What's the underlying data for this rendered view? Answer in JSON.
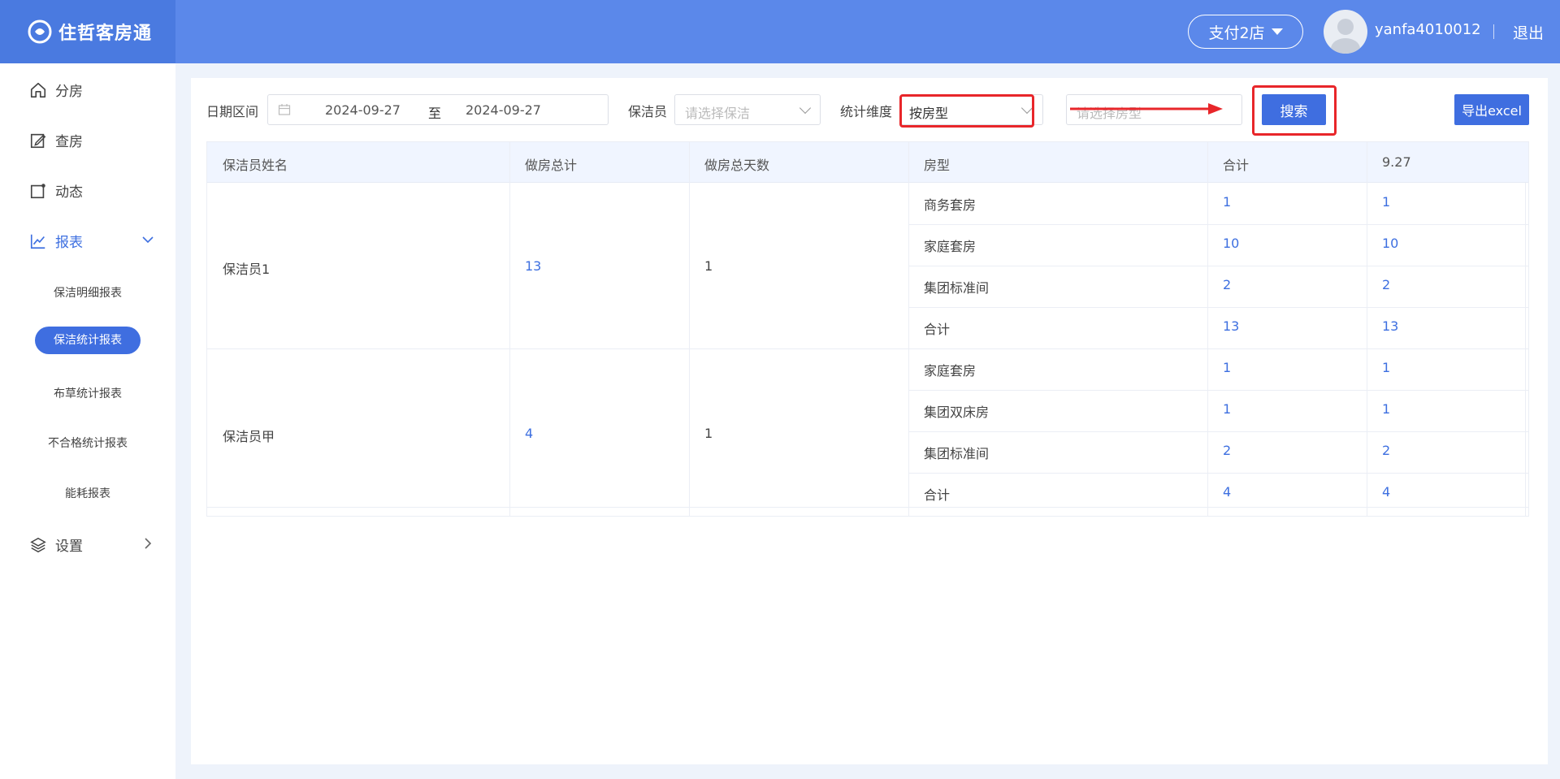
{
  "header": {
    "logo_text": "住哲客房通",
    "store_label": "支付2店",
    "username": "yanfa4010012",
    "logout_label": "退出"
  },
  "sidebar": {
    "items": [
      {
        "label": "分房",
        "icon": "home-icon"
      },
      {
        "label": "查房",
        "icon": "edit-icon"
      },
      {
        "label": "动态",
        "icon": "activity-icon"
      },
      {
        "label": "报表",
        "icon": "chart-icon"
      },
      {
        "label": "设置",
        "icon": "layers-icon"
      }
    ],
    "sub_items": [
      "保洁明细报表",
      "保洁统计报表",
      "布草统计报表",
      "不合格统计报表",
      "能耗报表"
    ]
  },
  "filters": {
    "date_label": "日期区间",
    "date_start": "2024-09-27",
    "date_sep": "至",
    "date_end": "2024-09-27",
    "cleaner_label": "保洁员",
    "cleaner_placeholder": "请选择保洁",
    "dimension_label": "统计维度",
    "dimension_value": "按房型",
    "roomtype_placeholder": "请选择房型",
    "search_label": "搜索",
    "export_label": "导出excel"
  },
  "table": {
    "headers": [
      "保洁员姓名",
      "做房总计",
      "做房总天数",
      "房型",
      "合计",
      "9.27"
    ],
    "groups": [
      {
        "name": "保洁员1",
        "total": "13",
        "days": "1",
        "rows": [
          {
            "type": "商务套房",
            "sum": "1",
            "d927": "1"
          },
          {
            "type": "家庭套房",
            "sum": "10",
            "d927": "10"
          },
          {
            "type": "集团标准间",
            "sum": "2",
            "d927": "2"
          },
          {
            "type": "合计",
            "sum": "13",
            "d927": "13"
          }
        ]
      },
      {
        "name": "保洁员甲",
        "total": "4",
        "days": "1",
        "rows": [
          {
            "type": "家庭套房",
            "sum": "1",
            "d927": "1"
          },
          {
            "type": "集团双床房",
            "sum": "1",
            "d927": "1"
          },
          {
            "type": "集团标准间",
            "sum": "2",
            "d927": "2"
          },
          {
            "type": "合计",
            "sum": "4",
            "d927": "4"
          }
        ]
      }
    ]
  },
  "colors": {
    "header_bg": "#5b88ea",
    "accent": "#3f6ee0",
    "annotation_red": "#e8262a"
  }
}
